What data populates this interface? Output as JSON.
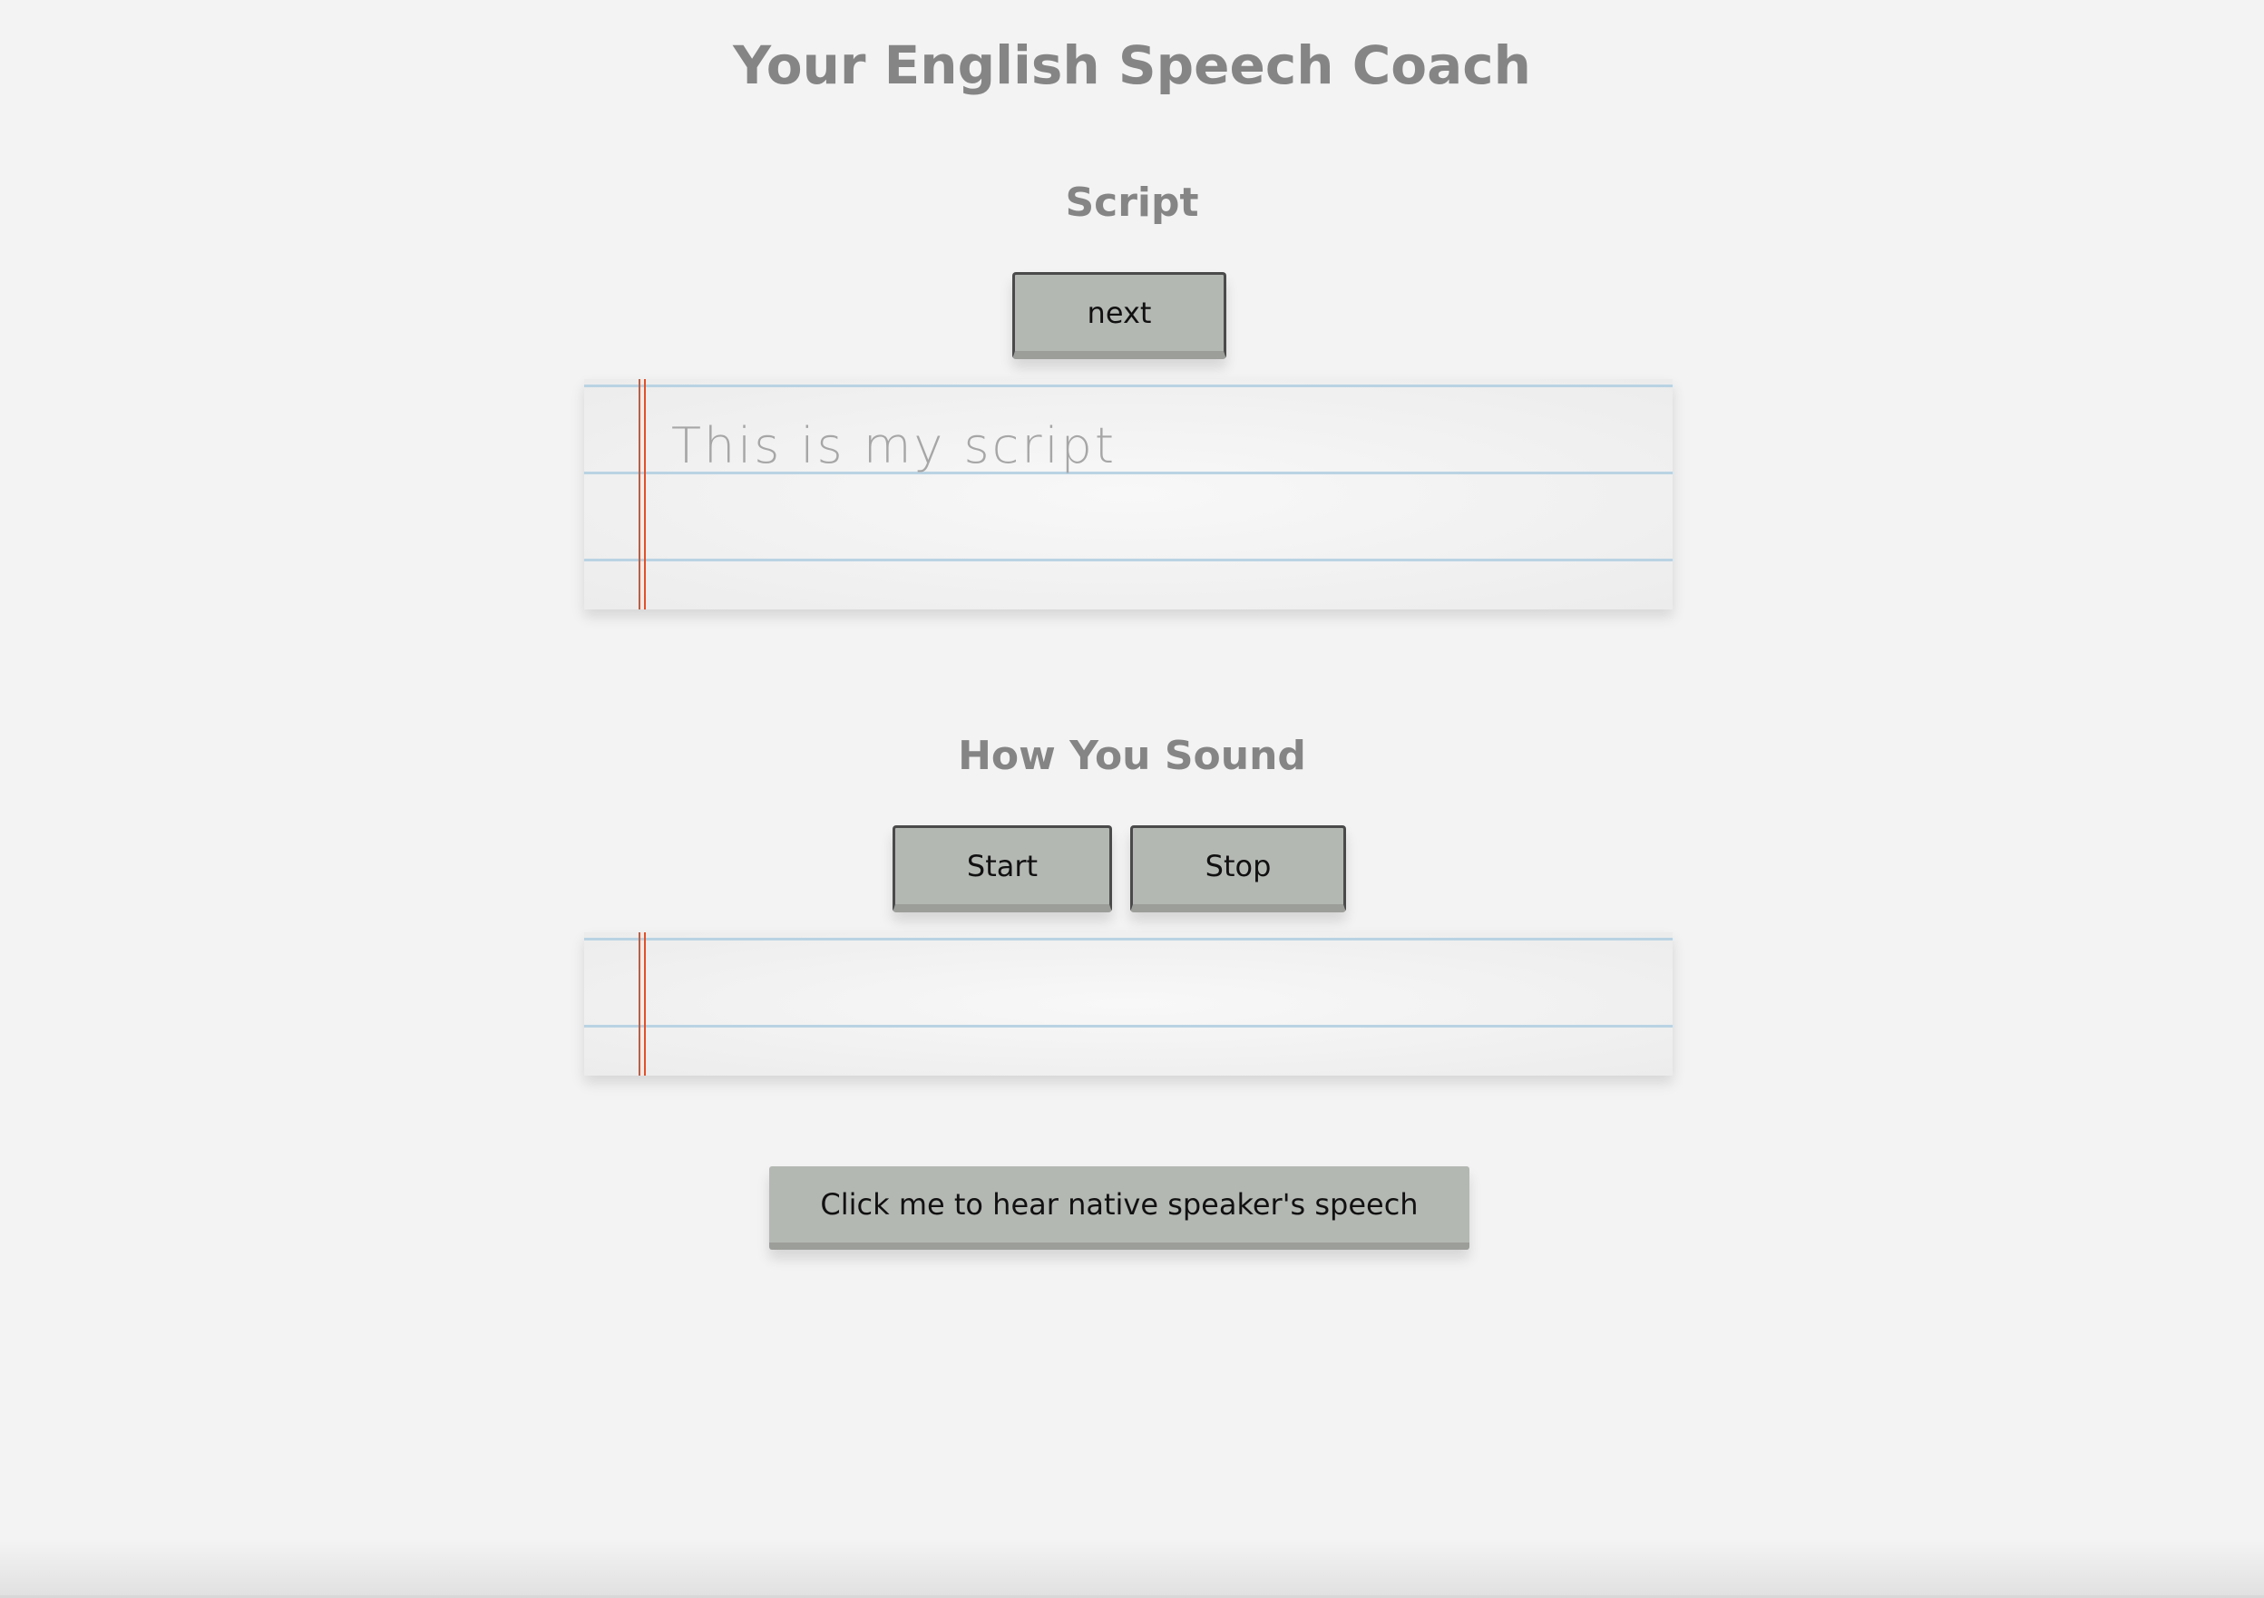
{
  "header": {
    "title": "Your English Speech Coach"
  },
  "script_section": {
    "heading": "Script",
    "next_label": "next",
    "script_text": "This is my script"
  },
  "sound_section": {
    "heading": "How You Sound",
    "start_label": "Start",
    "stop_label": "Stop",
    "transcript_text": ""
  },
  "native_button": {
    "label": "Click me to hear native speaker's speech"
  },
  "colors": {
    "background": "#f3f3f3",
    "button": "#b4b8b3",
    "paper_rule": "#b9d3e3",
    "paper_margin": "#d9542e",
    "heading_text": "#858585"
  }
}
